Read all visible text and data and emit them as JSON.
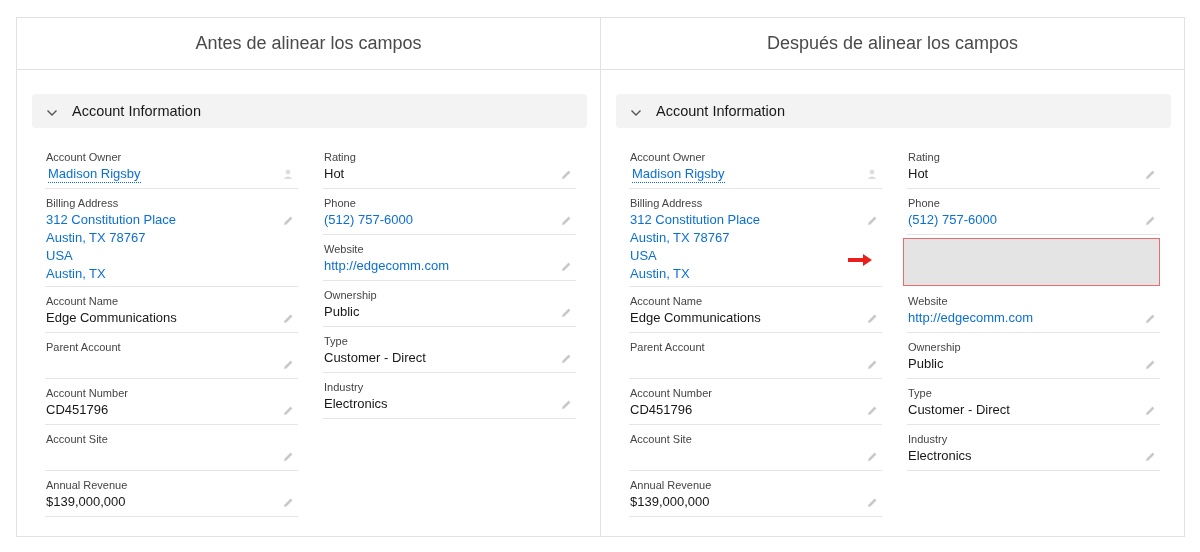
{
  "panels": [
    {
      "title": "Antes de alinear los campos",
      "section": {
        "title": "Account Information",
        "expanded": true,
        "columns": [
          [
            {
              "kind": "lookup",
              "label": "Account Owner",
              "lines": [
                "Madison Rigsby"
              ],
              "link": true
            },
            {
              "kind": "field",
              "label": "Billing Address",
              "lines": [
                "312 Constitution Place",
                "Austin, TX 78767",
                "USA",
                "Austin, TX"
              ],
              "link": true
            },
            {
              "kind": "field",
              "label": "Account Name",
              "lines": [
                "Edge Communications"
              ],
              "link": false
            },
            {
              "kind": "field",
              "label": "Parent Account"
            },
            {
              "kind": "field",
              "label": "Account Number",
              "lines": [
                "CD451796"
              ],
              "link": false
            },
            {
              "kind": "field",
              "label": "Account Site"
            },
            {
              "kind": "field",
              "label": "Annual Revenue",
              "lines": [
                "$139,000,000"
              ],
              "link": false
            }
          ],
          [
            {
              "kind": "field",
              "label": "Rating",
              "lines": [
                "Hot"
              ],
              "link": false
            },
            {
              "kind": "field",
              "label": "Phone",
              "lines": [
                "(512) 757-6000"
              ],
              "link": true
            },
            {
              "kind": "field",
              "label": "Website",
              "lines": [
                "http://edgecomm.com"
              ],
              "link": true
            },
            {
              "kind": "field",
              "label": "Ownership",
              "lines": [
                "Public"
              ],
              "link": false
            },
            {
              "kind": "field",
              "label": "Type",
              "lines": [
                "Customer - Direct"
              ],
              "link": false
            },
            {
              "kind": "field",
              "label": "Industry",
              "lines": [
                "Electronics"
              ],
              "link": false
            }
          ]
        ]
      }
    },
    {
      "title": "Después de alinear los campos",
      "section": {
        "title": "Account Information",
        "expanded": true,
        "columns": [
          [
            {
              "kind": "lookup",
              "label": "Account Owner",
              "lines": [
                "Madison Rigsby"
              ],
              "link": true
            },
            {
              "kind": "field",
              "label": "Billing Address",
              "lines": [
                "312 Constitution Place",
                "Austin, TX 78767",
                "USA",
                "Austin, TX"
              ],
              "link": true
            },
            {
              "kind": "field",
              "label": "Account Name",
              "lines": [
                "Edge Communications"
              ],
              "link": false
            },
            {
              "kind": "field",
              "label": "Parent Account"
            },
            {
              "kind": "field",
              "label": "Account Number",
              "lines": [
                "CD451796"
              ],
              "link": false
            },
            {
              "kind": "field",
              "label": "Account Site"
            },
            {
              "kind": "field",
              "label": "Annual Revenue",
              "lines": [
                "$139,000,000"
              ],
              "link": false
            }
          ],
          [
            {
              "kind": "field",
              "label": "Rating",
              "lines": [
                "Hot"
              ],
              "link": false
            },
            {
              "kind": "field",
              "label": "Phone",
              "lines": [
                "(512) 757-6000"
              ],
              "link": true
            },
            {
              "kind": "spacer",
              "highlighted": true
            },
            {
              "kind": "field",
              "label": "Website",
              "lines": [
                "http://edgecomm.com"
              ],
              "link": true
            },
            {
              "kind": "field",
              "label": "Ownership",
              "lines": [
                "Public"
              ],
              "link": false
            },
            {
              "kind": "field",
              "label": "Type",
              "lines": [
                "Customer - Direct"
              ],
              "link": false
            },
            {
              "kind": "field",
              "label": "Industry",
              "lines": [
                "Electronics"
              ],
              "link": false
            }
          ]
        ]
      }
    }
  ]
}
